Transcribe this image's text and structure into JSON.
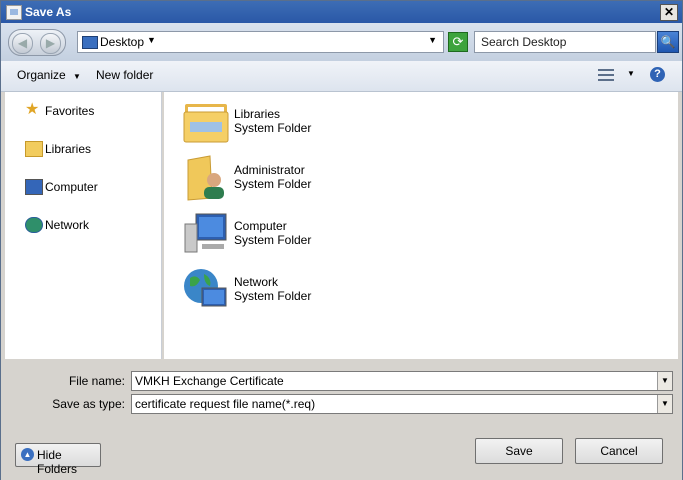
{
  "window": {
    "title": "Save As",
    "close": "✕"
  },
  "nav": {
    "back": "◀",
    "forward": "▶",
    "refresh": "⟳"
  },
  "address": {
    "location": "Desktop"
  },
  "search": {
    "placeholder": "Search Desktop",
    "button": "🔍"
  },
  "toolbar": {
    "organize": "Organize",
    "new_folder": "New folder",
    "help": "?"
  },
  "sidebar": {
    "items": [
      {
        "label": "Favorites",
        "icon": "star-icon"
      },
      {
        "label": "Libraries",
        "icon": "libraries-icon"
      },
      {
        "label": "Computer",
        "icon": "computer-icon"
      },
      {
        "label": "Network",
        "icon": "network-icon"
      }
    ]
  },
  "files": [
    {
      "name": "Libraries",
      "type": "System Folder",
      "icon": "libraries-folder-icon"
    },
    {
      "name": "Administrator",
      "type": "System Folder",
      "icon": "user-folder-icon"
    },
    {
      "name": "Computer",
      "type": "System Folder",
      "icon": "computer-icon"
    },
    {
      "name": "Network",
      "type": "System Folder",
      "icon": "network-globe-icon"
    }
  ],
  "form": {
    "file_name_label": "File name:",
    "file_name_value": "VMKH Exchange Certificate",
    "save_type_label": "Save as type:",
    "save_type_value": "certificate request file name(*.req)"
  },
  "buttons": {
    "hide_folders": "Hide Folders",
    "save": "Save",
    "cancel": "Cancel"
  },
  "colors": {
    "title_bar": "#2a58a7",
    "pane_bg": "#ffffff",
    "chrome_bg": "#d6d3ce"
  }
}
